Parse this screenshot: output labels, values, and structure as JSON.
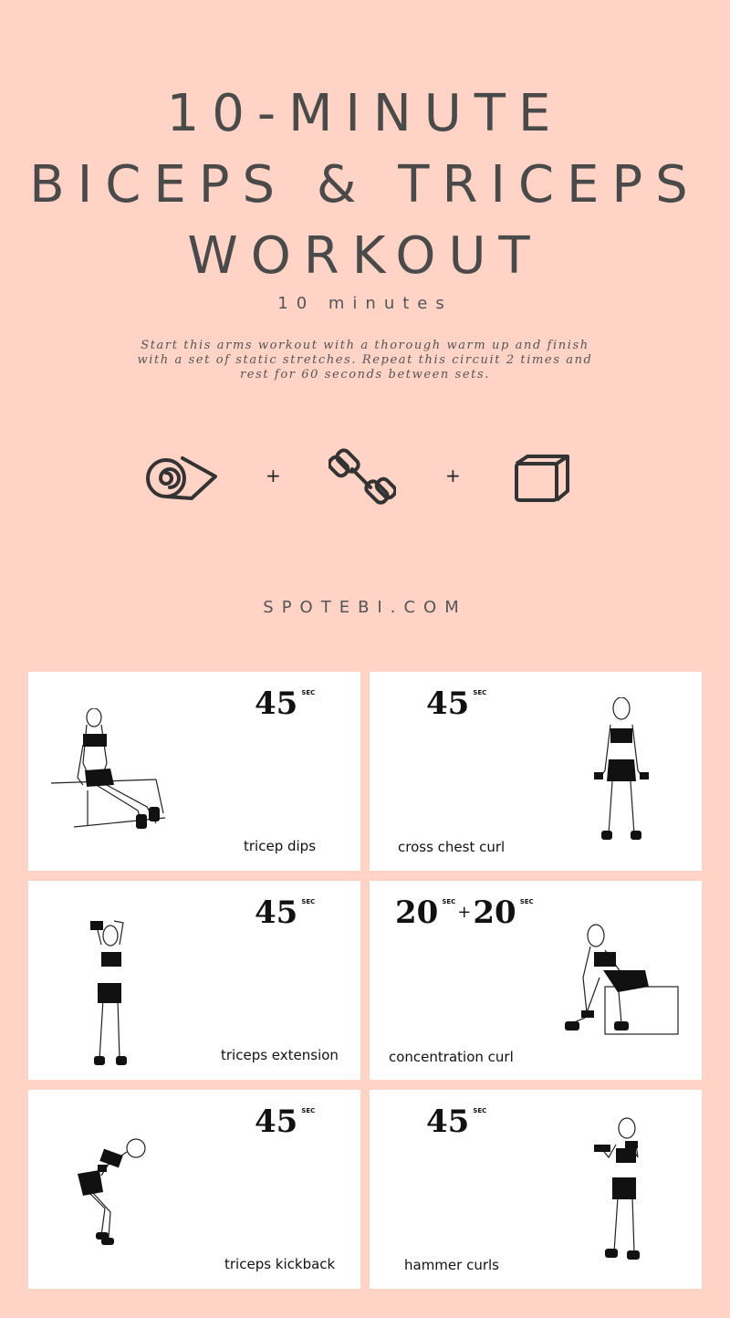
{
  "header": {
    "title_line1": "10-MINUTE",
    "title_line2": "BICEPS & TRICEPS",
    "title_line3": "WORKOUT",
    "subtitle": "10 minutes",
    "description": "Start this arms workout with a thorough warm up and finish with a set of static stretches. Repeat this circuit 2 times and rest for 60 seconds between sets."
  },
  "equipment": {
    "items": [
      "mat-icon",
      "dumbbell-icon",
      "box-icon"
    ],
    "separator": "+"
  },
  "site": "SPOTEBI.COM",
  "exercises": [
    {
      "name": "tricep dips",
      "time": "45",
      "unit": "SEC"
    },
    {
      "name": "cross chest curl",
      "time": "45",
      "unit": "SEC"
    },
    {
      "name": "triceps extension",
      "time": "45",
      "unit": "SEC"
    },
    {
      "name": "concentration curl",
      "time_a": "20",
      "time_b": "20",
      "unit": "SEC",
      "joiner": "+"
    },
    {
      "name": "triceps kickback",
      "time": "45",
      "unit": "SEC"
    },
    {
      "name": "hammer curls",
      "time": "45",
      "unit": "SEC"
    }
  ],
  "colors": {
    "background": "#ffd3c5",
    "card": "#ffffff",
    "text": "#4a4a4a"
  }
}
